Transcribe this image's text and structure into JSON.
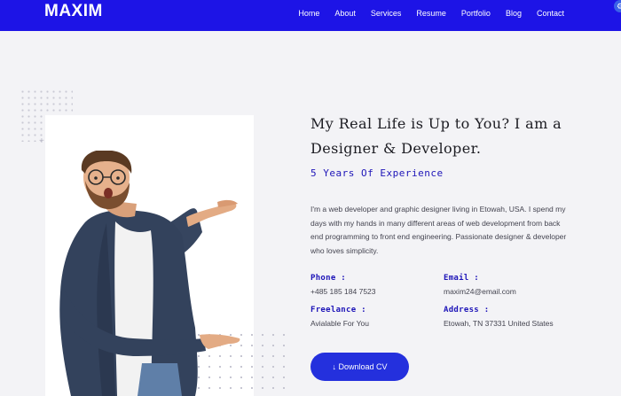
{
  "navbar": {
    "logo": "MAXIM",
    "links": [
      "Home",
      "About",
      "Services",
      "Resume",
      "Portfolio",
      "Blog",
      "Contact"
    ],
    "bg_color": "#1d14e6"
  },
  "hero": {
    "headline": "My Real Life is Up to You? I am a Designer & Developer.",
    "experience": "5 Years Of Experience",
    "bio": "I'm a web developer and graphic designer living in Etowah, USA. I spend my days with my hands in many different areas of web development from back end programming to front end engineering. Passionate designer & developer who loves simplicity.",
    "info": {
      "phone_label": "Phone :",
      "phone_value": "+485 185 184 7523",
      "email_label": "Email :",
      "email_value": "maxim24@email.com",
      "freelance_label": "Freelance :",
      "freelance_value": "Avialable For You",
      "address_label": "Address :",
      "address_value": "Etowah, TN 37331 United States"
    },
    "button_label": "Download CV",
    "button_icon": "download-icon"
  },
  "colors": {
    "accent": "#1d14b8",
    "button": "#2430dd",
    "background": "#f3f3f6"
  }
}
